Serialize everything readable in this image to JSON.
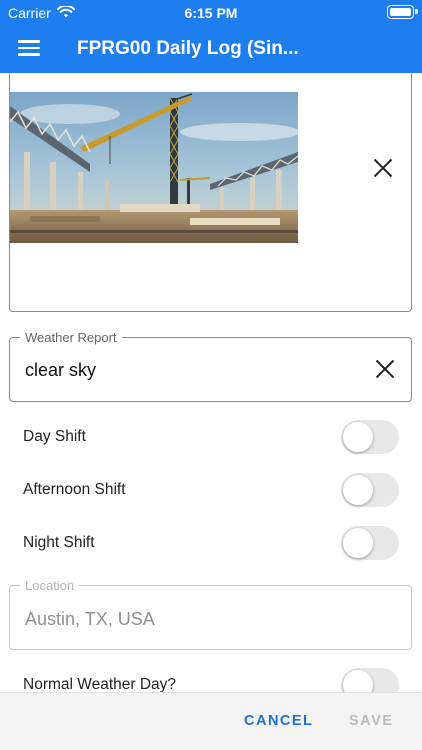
{
  "status_bar": {
    "carrier": "Carrier",
    "time": "6:15 PM"
  },
  "header": {
    "title": "FPRG00 Daily Log (Sin...",
    "menu_icon": "hamburger-menu-icon",
    "accent_color": "#1e7ef0"
  },
  "photo_section": {
    "image": "construction-site-photo",
    "remove_icon": "close-icon"
  },
  "weather_report": {
    "label": "Weather Report",
    "value": "clear sky",
    "clear_icon": "close-icon"
  },
  "shifts": [
    {
      "label": "Day Shift",
      "on": false
    },
    {
      "label": "Afternoon Shift",
      "on": false
    },
    {
      "label": "Night Shift",
      "on": false
    }
  ],
  "location": {
    "label": "Location",
    "value": "Austin, TX, USA",
    "disabled": true
  },
  "normal_weather_day": {
    "label": "Normal Weather Day?",
    "on": false
  },
  "actions": {
    "cancel_label": "CANCEL",
    "save_label": "SAVE",
    "save_disabled": true
  }
}
